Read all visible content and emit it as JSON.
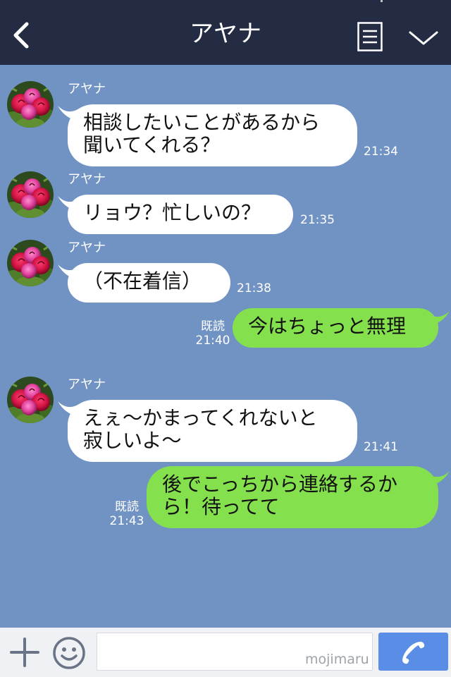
{
  "header": {
    "title": "アヤナ",
    "back_icon": "chevron-left-icon",
    "menu_icon": "menu-list-icon",
    "collapse_icon": "chevron-down-icon"
  },
  "messages": [
    {
      "direction": "in",
      "sender": "アヤナ",
      "lines": [
        "相談したいことがあるから",
        "聞いてくれる？"
      ],
      "time": "21:34"
    },
    {
      "direction": "in",
      "sender": "アヤナ",
      "lines": [
        "リョウ？忙しいの？"
      ],
      "time": "21:35"
    },
    {
      "direction": "in",
      "sender": "アヤナ",
      "lines": [
        "（不在着信）"
      ],
      "time": "21:38"
    },
    {
      "direction": "out",
      "read": "既読",
      "lines": [
        "今はちょっと無理"
      ],
      "time": "21:40"
    },
    {
      "direction": "in",
      "sender": "アヤナ",
      "lines": [
        "えぇ〜かまってくれないと",
        "寂しいよ〜"
      ],
      "time": "21:41"
    },
    {
      "direction": "out",
      "read": "既読",
      "lines": [
        "後でこっちから連絡するか",
        "ら！待ってて"
      ],
      "time": "21:43"
    }
  ],
  "input_bar": {
    "plus_icon": "plus-icon",
    "emoji_icon": "smiley-icon",
    "message_value": "",
    "call_icon": "phone-icon",
    "watermark": "mojimaru"
  },
  "colors": {
    "header_bg": "#232c42",
    "chat_bg": "#7193c4",
    "incoming_bubble": "#ffffff",
    "outgoing_bubble": "#84e14d",
    "call_button": "#5a8de6"
  }
}
